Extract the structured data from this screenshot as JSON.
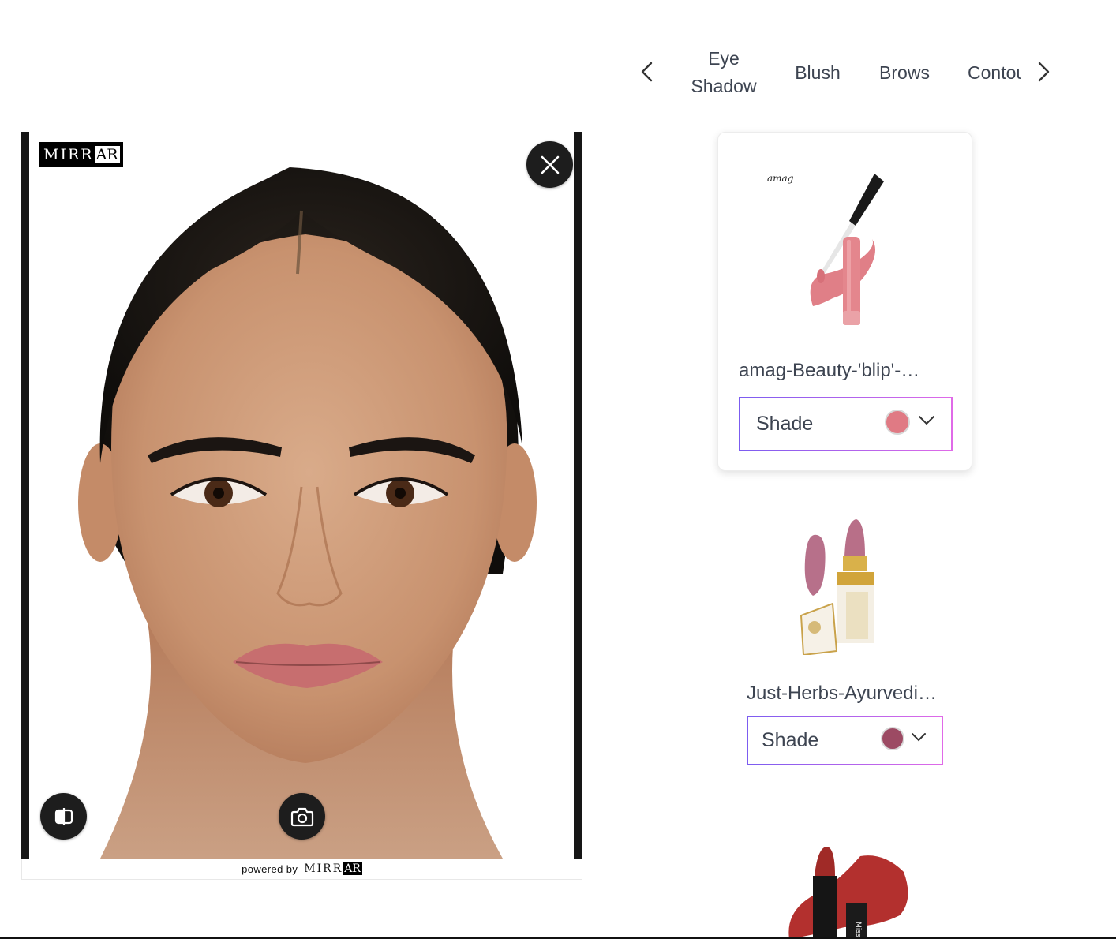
{
  "tryon": {
    "logo_text": "MIRR",
    "logo_ar": "AR",
    "footer_prefix": "powered by",
    "footer_brand": "MIRR",
    "footer_ar": "AR",
    "icons": {
      "close": "close-icon",
      "compare": "compare-icon",
      "capture": "camera-icon"
    }
  },
  "categories": {
    "items": [
      {
        "label": "Eye\nShadow"
      },
      {
        "label": "Blush"
      },
      {
        "label": "Brows"
      },
      {
        "label": "Contour"
      }
    ],
    "prev_icon": "chevron-left-icon",
    "next_icon": "chevron-right-icon"
  },
  "products": [
    {
      "name": "amag-Beauty-'blip'-…",
      "brand_mark": "amag",
      "shade_label": "Shade",
      "shade_color": "#e07a84"
    },
    {
      "name": "Just-Herbs-Ayurvedi…",
      "shade_label": "Shade",
      "shade_color": "#9c4a63"
    },
    {
      "name": "",
      "shade_label": "",
      "shade_color": "#b3302e"
    }
  ],
  "colors": {
    "accent_gradient_start": "#7b5cf0",
    "accent_gradient_end": "#e06ae8",
    "dark_button": "#1d1d1d"
  }
}
